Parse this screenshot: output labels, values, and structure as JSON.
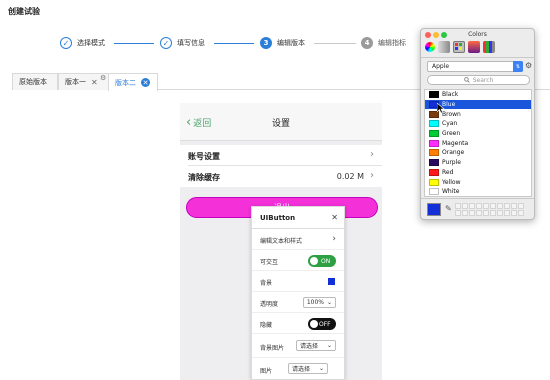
{
  "page": {
    "title": "创建试验"
  },
  "stepper": {
    "steps": [
      {
        "label": "选择模式",
        "state": "done",
        "mark": "✓"
      },
      {
        "label": "填写信息",
        "state": "done",
        "mark": "✓"
      },
      {
        "label": "编辑版本",
        "state": "active",
        "mark": "3"
      },
      {
        "label": "编辑指标",
        "state": "todo",
        "mark": "4"
      }
    ]
  },
  "tabs": {
    "items": [
      {
        "label": "原始版本"
      },
      {
        "label": "版本一",
        "close": "✕"
      },
      {
        "label": "版本二",
        "close": "✕"
      }
    ],
    "add": "+"
  },
  "phone": {
    "nav": {
      "back_label": "返回",
      "back_chevron": "‹",
      "title": "设置"
    },
    "rows": [
      {
        "label": "账号设置",
        "chevron": "›"
      },
      {
        "label": "清除缓存",
        "value": "0.02 M",
        "chevron": "›"
      }
    ],
    "primary_button_label": "退出"
  },
  "inspector": {
    "title": "UIButton",
    "close": "✕",
    "rows": {
      "text_style": {
        "label": "编辑文本和样式",
        "chevron": "›"
      },
      "interactable": {
        "label": "可交互",
        "toggle": "ON"
      },
      "background": {
        "label": "背景",
        "color": "#1330d8"
      },
      "opacity": {
        "label": "透明度",
        "value": "100%"
      },
      "hidden": {
        "label": "隐藏",
        "toggle": "OFF"
      },
      "bg_image": {
        "label": "背景图片",
        "value": "请选择"
      },
      "image": {
        "label": "图片",
        "value": "请选择"
      }
    },
    "select_arrow": "⌄"
  },
  "colors_panel": {
    "title": "Colors",
    "palette": "Apple",
    "search_placeholder": "Search",
    "current_color": "#1330d8",
    "colors": [
      {
        "name": "Black",
        "hex": "#000000"
      },
      {
        "name": "Blue",
        "hex": "#1330d8",
        "selected": true
      },
      {
        "name": "Brown",
        "hex": "#7a3b10"
      },
      {
        "name": "Cyan",
        "hex": "#00ffff"
      },
      {
        "name": "Green",
        "hex": "#00cc33"
      },
      {
        "name": "Magenta",
        "hex": "#ff2bff"
      },
      {
        "name": "Orange",
        "hex": "#ff8000"
      },
      {
        "name": "Purple",
        "hex": "#2a0a5e"
      },
      {
        "name": "Red",
        "hex": "#ff1a1a"
      },
      {
        "name": "Yellow",
        "hex": "#ffff00"
      },
      {
        "name": "White",
        "hex": "#ffffff"
      }
    ]
  },
  "colors": {
    "accent": "#2b7fd9",
    "nav_green": "#4aa26c",
    "primary_button": "#f430d9",
    "toggle_on": "#2ea043"
  }
}
